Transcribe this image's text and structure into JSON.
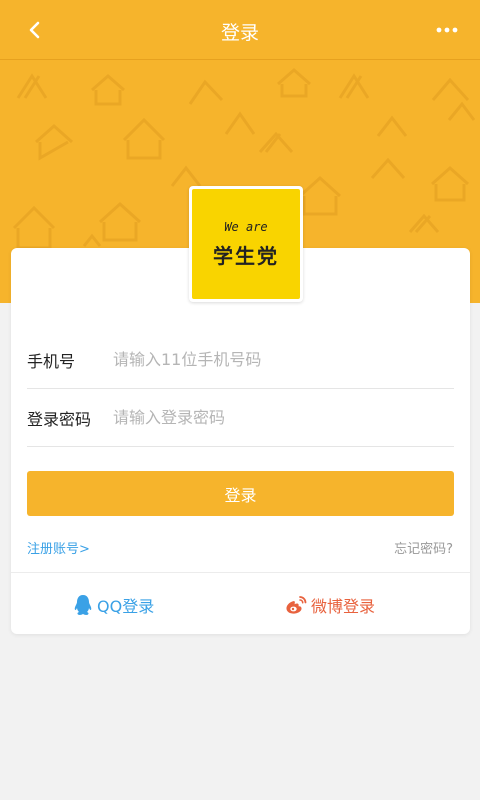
{
  "navbar": {
    "title": "登录",
    "back_icon": "chevron-left-icon",
    "more_icon": "more-dots-icon"
  },
  "logo": {
    "top_text": "We are",
    "main_text": "学生党"
  },
  "form": {
    "phone_label": "手机号",
    "phone_placeholder": "请输入11位手机号码",
    "phone_value": "",
    "password_label": "登录密码",
    "password_placeholder": "请输入登录密码",
    "password_value": "",
    "login_button": "登录"
  },
  "links": {
    "register": "注册账号>",
    "forgot": "忘记密码?"
  },
  "social": {
    "qq_label": "QQ登录",
    "weibo_label": "微博登录"
  },
  "colors": {
    "brand_orange": "#f6b42c",
    "logo_yellow": "#f9d400",
    "link_blue": "#3aa1e6",
    "weibo_red": "#e8623e"
  }
}
